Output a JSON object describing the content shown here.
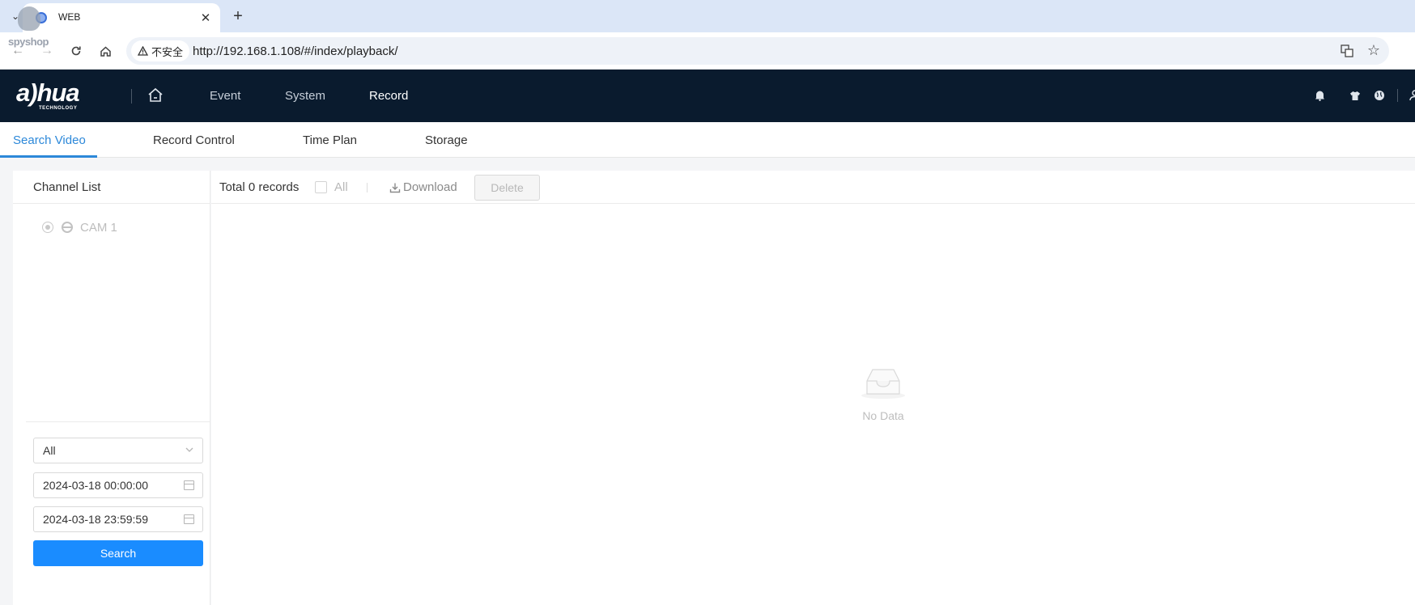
{
  "browser": {
    "tab": {
      "title": "WEB",
      "favicon": "web-favicon"
    },
    "insecure_label": "不安全",
    "url": "http://192.168.1.108/#/index/playback/",
    "watermark": "spyshop"
  },
  "header": {
    "logo_text": "a)hua",
    "logo_sub": "TECHNOLOGY",
    "nav": [
      {
        "label": "Event"
      },
      {
        "label": "System"
      },
      {
        "label": "Record",
        "active": true
      }
    ],
    "icons": [
      "bell-icon",
      "shirt-icon",
      "globe-icon",
      "user-icon"
    ]
  },
  "subtabs": [
    {
      "label": "Search Video",
      "active": true
    },
    {
      "label": "Record Control"
    },
    {
      "label": "Time Plan"
    },
    {
      "label": "Storage"
    }
  ],
  "channel_list": {
    "title": "Channel List",
    "channels": [
      {
        "label": "CAM 1"
      }
    ]
  },
  "filters": {
    "type_select": "All",
    "start_time": "2024-03-18 00:00:00",
    "end_time": "2024-03-18 23:59:59",
    "search_label": "Search"
  },
  "records": {
    "total_label": "Total 0 records",
    "all_label": "All",
    "download_label": "Download",
    "delete_label": "Delete",
    "empty_text": "No Data"
  },
  "colors": {
    "accent": "#1a8cff",
    "tab_active": "#2c88d9",
    "header_bg": "#0a1b2e"
  }
}
